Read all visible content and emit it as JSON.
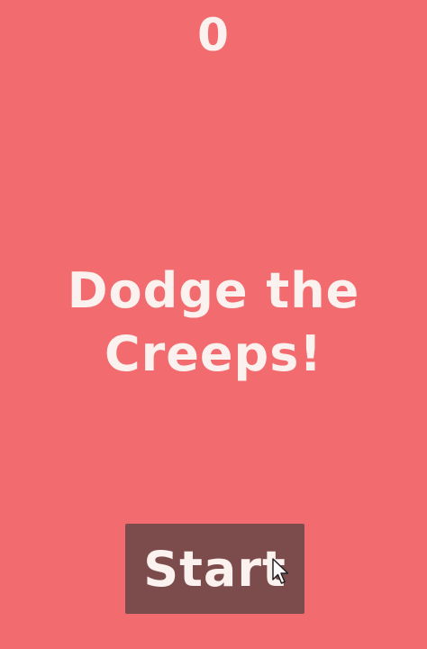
{
  "hud": {
    "score": "0",
    "message_line1": "Dodge the",
    "message_line2": "Creeps!",
    "start_label": "Start"
  },
  "colors": {
    "background": "#f26b6e",
    "button": "#7c4c4d",
    "text": "#fbf1ee"
  },
  "icons": {
    "cursor": "mouse-pointer-icon"
  }
}
